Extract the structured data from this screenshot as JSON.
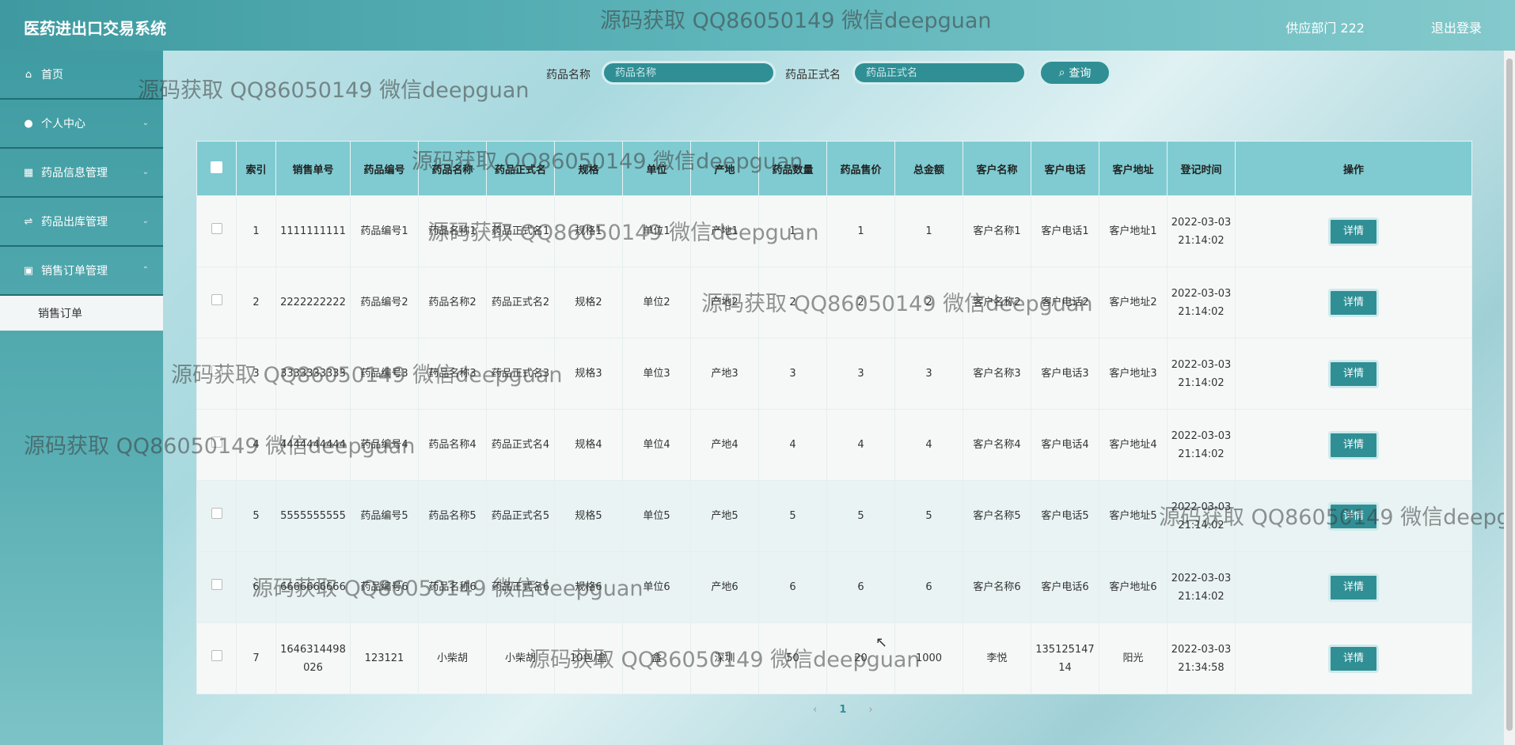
{
  "header": {
    "title": "医药进出口交易系统",
    "user": "供应部门 222",
    "logout": "退出登录"
  },
  "sidebar": {
    "items": [
      {
        "icon": "home-icon",
        "label": "首页"
      },
      {
        "icon": "user-icon",
        "label": "个人中心"
      },
      {
        "icon": "grid-icon",
        "label": "药品信息管理"
      },
      {
        "icon": "export-icon",
        "label": "药品出库管理"
      },
      {
        "icon": "lock-icon",
        "label": "销售订单管理"
      }
    ],
    "sub_item": "销售订单"
  },
  "search": {
    "name_label": "药品名称",
    "name_placeholder": "药品名称",
    "formal_label": "药品正式名",
    "formal_placeholder": "药品正式名",
    "button": "查询"
  },
  "table": {
    "headers": [
      "索引",
      "销售单号",
      "药品编号",
      "药品名称",
      "药品正式名",
      "规格",
      "单位",
      "产地",
      "药品数量",
      "药品售价",
      "总金额",
      "客户名称",
      "客户电话",
      "客户地址",
      "登记时间",
      "操作"
    ],
    "rows": [
      [
        "1",
        "1111111111",
        "药品编号1",
        "药品名称1",
        "药品正式名1",
        "规格1",
        "单位1",
        "产地1",
        "1",
        "1",
        "1",
        "客户名称1",
        "客户电话1",
        "客户地址1",
        "2022-03-03 21:14:02"
      ],
      [
        "2",
        "2222222222",
        "药品编号2",
        "药品名称2",
        "药品正式名2",
        "规格2",
        "单位2",
        "产地2",
        "2",
        "2",
        "2",
        "客户名称2",
        "客户电话2",
        "客户地址2",
        "2022-03-03 21:14:02"
      ],
      [
        "3",
        "3333333333",
        "药品编号3",
        "药品名称3",
        "药品正式名3",
        "规格3",
        "单位3",
        "产地3",
        "3",
        "3",
        "3",
        "客户名称3",
        "客户电话3",
        "客户地址3",
        "2022-03-03 21:14:02"
      ],
      [
        "4",
        "4444444444",
        "药品编号4",
        "药品名称4",
        "药品正式名4",
        "规格4",
        "单位4",
        "产地4",
        "4",
        "4",
        "4",
        "客户名称4",
        "客户电话4",
        "客户地址4",
        "2022-03-03 21:14:02"
      ],
      [
        "5",
        "5555555555",
        "药品编号5",
        "药品名称5",
        "药品正式名5",
        "规格5",
        "单位5",
        "产地5",
        "5",
        "5",
        "5",
        "客户名称5",
        "客户电话5",
        "客户地址5",
        "2022-03-03 21:14:02"
      ],
      [
        "6",
        "6666666666",
        "药品编号6",
        "药品名称6",
        "药品正式名6",
        "规格6",
        "单位6",
        "产地6",
        "6",
        "6",
        "6",
        "客户名称6",
        "客户电话6",
        "客户地址6",
        "2022-03-03 21:14:02"
      ],
      [
        "7",
        "1646314498026",
        "123121",
        "小柴胡",
        "小柴胡",
        "10包/盒",
        "盒",
        "深圳",
        "50",
        "20",
        "1000",
        "李悦",
        "13512514714",
        "阳光",
        "2022-03-03 21:34:58"
      ]
    ],
    "detail_label": "详情"
  },
  "pager": {
    "prev": "‹",
    "current": "1",
    "next": "›"
  },
  "watermark": "源码获取 QQ86050149 微信deepguan"
}
